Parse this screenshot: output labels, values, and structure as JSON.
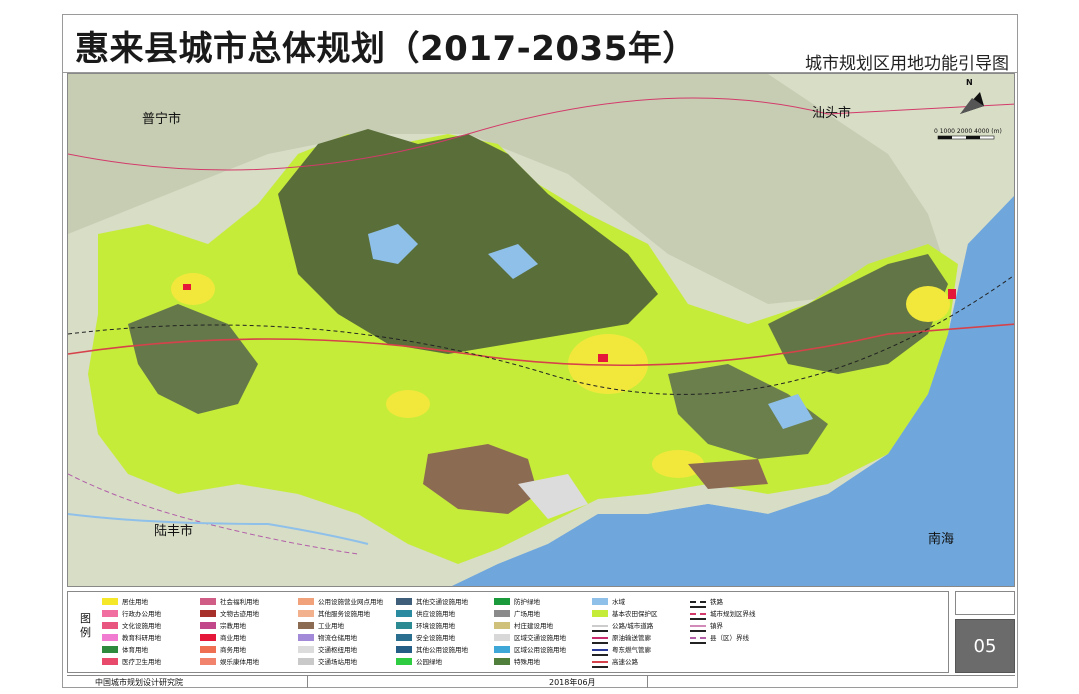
{
  "header": {
    "title": "惠来县城市总体规划（2017-2035年）",
    "subtitle": "城市规划区用地功能引导图"
  },
  "map": {
    "labels": {
      "puning": "普宁市",
      "shantou": "汕头市",
      "lufeng": "陆丰市",
      "nanhai": "南海"
    },
    "north_letter": "N",
    "scale_text": "0   1000 2000        4000 (m)",
    "colors": {
      "sea": "#6fa7dc",
      "mountain": "#5a6e3a",
      "land": "#d8ddc6",
      "farmland": "#c6ec3a",
      "residential": "#f2e83c",
      "industrial": "#8c6b53",
      "boundary": "#d33a6a"
    }
  },
  "legend": {
    "heading": "图例",
    "items": [
      {
        "label": "居住用地",
        "color": "#f5e829",
        "type": "fill"
      },
      {
        "label": "行政办公用地",
        "color": "#f06fa0",
        "type": "fill"
      },
      {
        "label": "文化设施用地",
        "color": "#e8557f",
        "type": "fill"
      },
      {
        "label": "教育科研用地",
        "color": "#f07bd0",
        "type": "fill"
      },
      {
        "label": "体育用地",
        "color": "#2e8b3e",
        "type": "fill"
      },
      {
        "label": "医疗卫生用地",
        "color": "#e84a6c",
        "type": "fill"
      },
      {
        "label": "社会福利用地",
        "color": "#d05d86",
        "type": "fill"
      },
      {
        "label": "文物古迹用地",
        "color": "#a8302a",
        "type": "fill"
      },
      {
        "label": "宗教用地",
        "color": "#c2478a",
        "type": "fill"
      },
      {
        "label": "商业用地",
        "color": "#e5183a",
        "type": "fill"
      },
      {
        "label": "商务用地",
        "color": "#ee6f52",
        "type": "fill"
      },
      {
        "label": "娱乐康体用地",
        "color": "#f1836c",
        "type": "fill"
      },
      {
        "label": "公用设施营业网点用地",
        "color": "#f2a27a",
        "type": "fill"
      },
      {
        "label": "其他服务设施用地",
        "color": "#f3b08c",
        "type": "fill"
      },
      {
        "label": "工业用地",
        "color": "#8c6b53",
        "type": "fill"
      },
      {
        "label": "物流仓储用地",
        "color": "#a28ad8",
        "type": "fill"
      },
      {
        "label": "交通枢纽用地",
        "color": "#dcdcdc",
        "type": "fill"
      },
      {
        "label": "交通场站用地",
        "color": "#c9c9c9",
        "type": "fill"
      },
      {
        "label": "其他交通设施用地",
        "color": "#3f5e7a",
        "type": "fill"
      },
      {
        "label": "供应设施用地",
        "color": "#2a8aa0",
        "type": "fill"
      },
      {
        "label": "环境设施用地",
        "color": "#2c8a92",
        "type": "fill"
      },
      {
        "label": "安全设施用地",
        "color": "#2a6f8f",
        "type": "fill"
      },
      {
        "label": "其他公用设施用地",
        "color": "#245e86",
        "type": "fill"
      },
      {
        "label": "公园绿地",
        "color": "#2ecc40",
        "type": "fill"
      },
      {
        "label": "防护绿地",
        "color": "#1a9a3a",
        "type": "fill"
      },
      {
        "label": "广场用地",
        "color": "#8a8a8a",
        "type": "fill"
      },
      {
        "label": "村庄建设用地",
        "color": "#cfc07a",
        "type": "fill"
      },
      {
        "label": "区域交通设施用地",
        "color": "#d8d8d8",
        "type": "fill"
      },
      {
        "label": "区域公用设施用地",
        "color": "#3fa6d8",
        "type": "fill"
      },
      {
        "label": "特殊用地",
        "color": "#4f7f3a",
        "type": "fill"
      },
      {
        "label": "水域",
        "color": "#8ec0ea",
        "type": "fill"
      },
      {
        "label": "基本农田保护区",
        "color": "#c6ec3a",
        "type": "fill"
      },
      {
        "label": "公路/城市道路",
        "color": "#cccccc",
        "type": "line"
      },
      {
        "label": "原油输送管廊",
        "color": "#c82a6a",
        "type": "line"
      },
      {
        "label": "粤东燃气管廊",
        "color": "#2a3a9a",
        "type": "line"
      },
      {
        "label": "高速公路",
        "color": "#d6424a",
        "type": "line"
      },
      {
        "label": "铁路",
        "color": "#222222",
        "type": "dash"
      },
      {
        "label": "城市规划区界线",
        "color": "#d33a6a",
        "type": "dash"
      },
      {
        "label": "镇界",
        "color": "#d28ab8",
        "type": "line"
      },
      {
        "label": "县（区）界线",
        "color": "#b25fa8",
        "type": "dash"
      }
    ]
  },
  "page_number": "05",
  "footer": {
    "institute": "中国城市规划设计研究院",
    "date": "2018年06月"
  }
}
